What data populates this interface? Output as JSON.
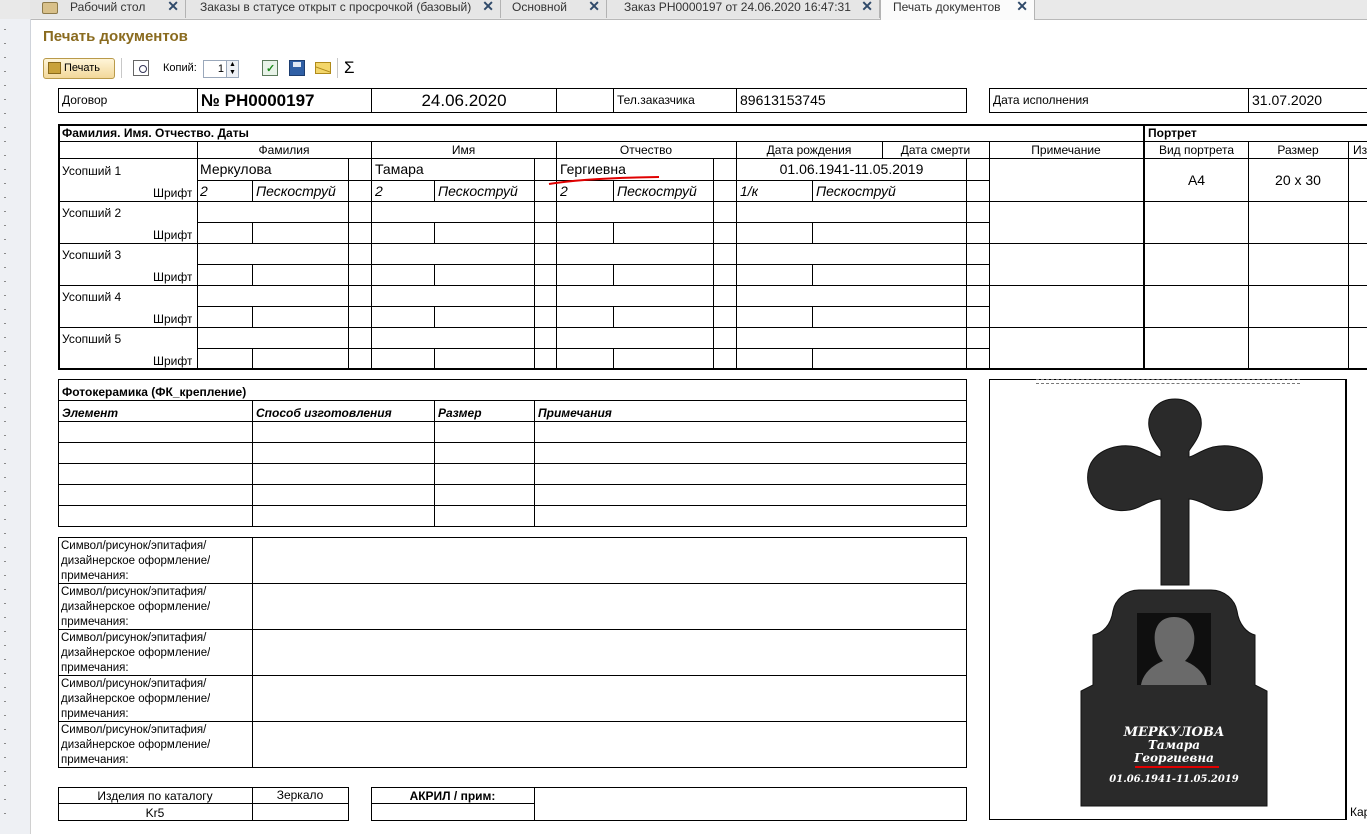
{
  "tabs": [
    {
      "label": "Рабочий стол"
    },
    {
      "label": "Заказы в статусе открыт с просрочкой (базовый)"
    },
    {
      "label": "Основной"
    },
    {
      "label": "Заказ РН0000197 от 24.06.2020 16:47:31"
    },
    {
      "label": "Печать документов"
    }
  ],
  "page_title": "Печать документов",
  "toolbar": {
    "print_label": "Печать",
    "copies_label": "Копий:",
    "copies_value": "1",
    "sum_symbol": "Σ"
  },
  "header": {
    "contract_label": "Договор",
    "contract_number": "№ РН0000197",
    "contract_date": "24.06.2020",
    "phone_label": "Тел.заказчика",
    "phone_value": "89613153745",
    "due_label": "Дата исполнения",
    "due_value": "31.07.2020"
  },
  "deceased": {
    "section_title": "Фамилия. Имя. Отчество. Даты",
    "portrait_title": "Портрет",
    "col_surname": "Фамилия",
    "col_name": "Имя",
    "col_patronymic": "Отчество",
    "col_birth": "Дата рождения",
    "col_death": "Дата смерти",
    "col_note": "Примечание",
    "col_portrait_type": "Вид портрета",
    "col_size": "Размер",
    "col_more": "Из",
    "font_label": "Шрифт",
    "rows": [
      {
        "label": "Усопший 1",
        "surname": "Меркулова",
        "name": "Тамара",
        "patronymic": "Гергиевна",
        "dates": "01.06.1941-11.05.2019",
        "font_surname_size": "2",
        "font_surname": "Пескоструй",
        "font_name_size": "2",
        "font_name": "Пескоструй",
        "font_patronymic_size": "2",
        "font_patronymic": "Пескоструй",
        "font_dates_size": "1/к",
        "font_dates": "Пескоструй",
        "portrait_type": "А4",
        "portrait_size": "20 х 30"
      },
      {
        "label": "Усопший 2"
      },
      {
        "label": "Усопший 3"
      },
      {
        "label": "Усопший 4"
      },
      {
        "label": "Усопший 5"
      }
    ]
  },
  "photoceramics": {
    "title": "Фотокерамика (ФК_крепление)",
    "col_element": "Элемент",
    "col_method": "Способ изготовления",
    "col_size": "Размер",
    "col_notes": "Примечания"
  },
  "symbol_rows": [
    "Символ/рисунок/эпитафия/\nдизайнерское оформление/\nпримечания:",
    "Символ/рисунок/эпитафия/\nдизайнерское оформление/\nпримечания:",
    "Символ/рисунок/эпитафия/\nдизайнерское оформление/\nпримечания:",
    "Символ/рисунок/эпитафия/\nдизайнерское оформление/\nпримечания:",
    "Символ/рисунок/эпитафия/\nдизайнерское оформление/\nпримечания:"
  ],
  "catalog": {
    "label": "Изделия по каталогу",
    "value": "Kr5",
    "mirror_label": "Зеркало",
    "acryl_label": "АКРИЛ / прим:"
  },
  "monument": {
    "line1": "МЕРКУЛОВА",
    "line2": "Тамара",
    "line3": "Георгиевна",
    "line4": "01.06.1941-11.05.2019",
    "right_cut_text": "Кар"
  },
  "colors": {
    "title": "#8a6b1f",
    "annotation": "#e00000",
    "monument": "#2a2a2a"
  }
}
